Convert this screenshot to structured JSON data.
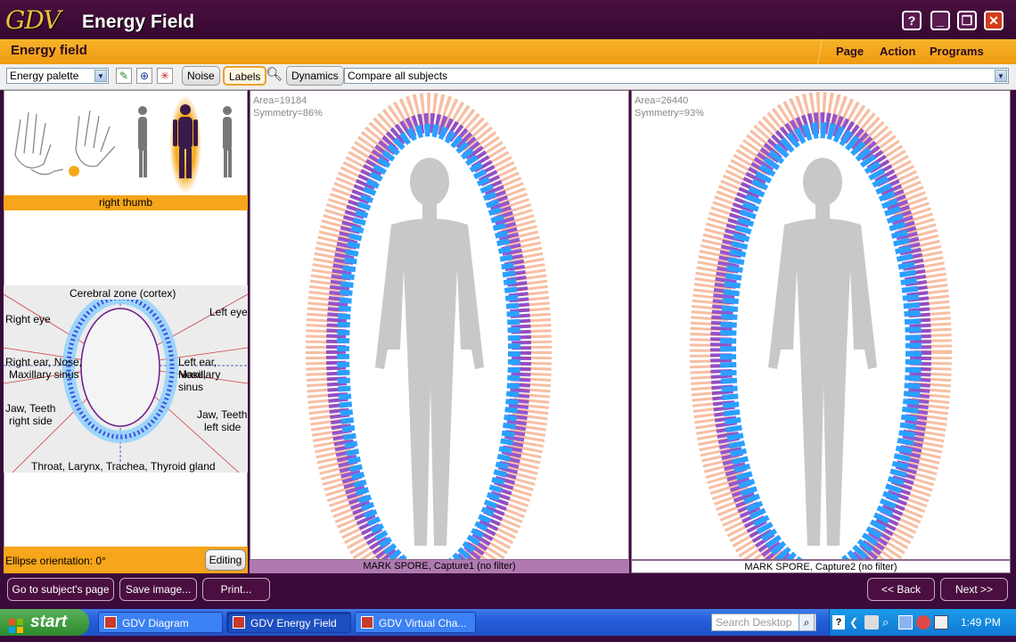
{
  "window": {
    "logo": "GDV",
    "title": "Energy Field",
    "help_label": "?",
    "minimize_label": "_",
    "maximize_label": "❐",
    "close_label": "✕"
  },
  "header": {
    "heading": "Energy field",
    "menu": [
      "Page",
      "Action",
      "Programs"
    ]
  },
  "toolbar": {
    "palette_select": "Energy palette",
    "noise_label": "Noise",
    "labels_label": "Labels",
    "dynamics_label": "Dynamics",
    "compare_select": "Compare all subjects"
  },
  "left_panel": {
    "selected_finger": "right thumb",
    "zones": {
      "top": "Cerebral zone (cortex)",
      "right_eye": "Right eye",
      "left_eye": "Left eye",
      "right_ear_1": "Right ear, Nose,",
      "right_ear_2": "Maxillary sinus",
      "left_ear_1": "Left ear, Nose,",
      "left_ear_2": "Maxillary sinus",
      "jaw_right_1": "Jaw, Teeth",
      "jaw_right_2": "right side",
      "jaw_left_1": "Jaw, Teeth",
      "jaw_left_2": "left side",
      "bottom": "Throat, Larynx, Trachea, Thyroid gland"
    },
    "ellipse_orientation": "Ellipse orientation: 0°",
    "editing_label": "Editing"
  },
  "captures": [
    {
      "area": "Area=19184",
      "symmetry": "Symmetry=86%",
      "caption": "MARK SPORE, Capture1 (no filter)"
    },
    {
      "area": "Area=26440",
      "symmetry": "Symmetry=93%",
      "caption": "MARK SPORE, Capture2 (no filter)"
    }
  ],
  "bottom_bar": {
    "subject_page": "Go to subject's page",
    "save_image": "Save image...",
    "print": "Print...",
    "back": "<< Back",
    "next": "Next >>"
  },
  "taskbar": {
    "start": "start",
    "tasks": [
      "GDV Diagram",
      "GDV Energy Field",
      "GDV Virtual Cha..."
    ],
    "search_placeholder": "Search Desktop",
    "clock": "1:49 PM"
  },
  "colors": {
    "title_bg": "#3a0a3a",
    "accent_orange": "#f7a51a",
    "aura_blue": "#2aa0ff",
    "aura_purple": "#7a30c8",
    "aura_peach": "#f4a37a"
  }
}
